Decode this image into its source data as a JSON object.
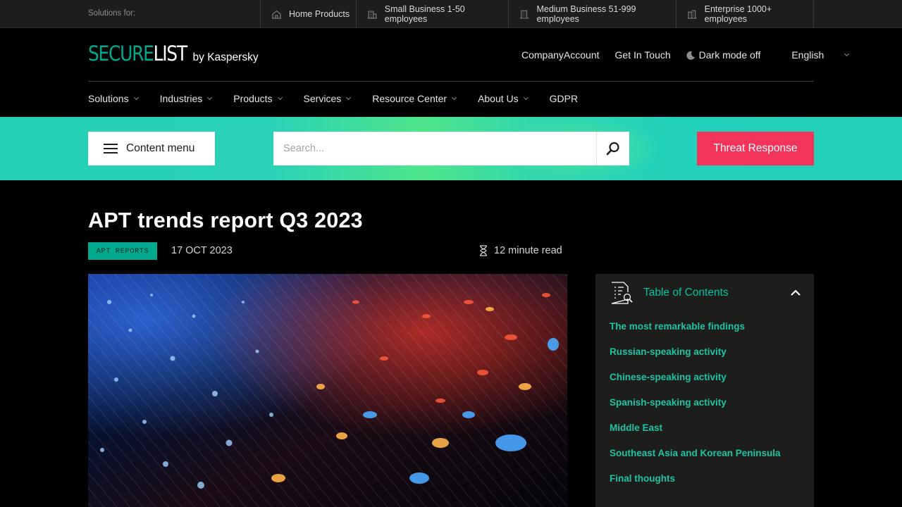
{
  "topbar": {
    "solutions_label": "Solutions for:",
    "segments": [
      {
        "icon": "house-icon",
        "label": "Home Products"
      },
      {
        "icon": "small-building-icon",
        "label": "Small Business 1-50 employees"
      },
      {
        "icon": "medium-building-icon",
        "label": "Medium Business 51-999 employees"
      },
      {
        "icon": "enterprise-building-icon",
        "label": "Enterprise 1000+ employees"
      }
    ]
  },
  "header": {
    "logo_secure": "SECURE",
    "logo_list": "LIST",
    "logo_by": "by Kaspersky",
    "links": {
      "company_account": "CompanyAccount",
      "get_in_touch": "Get In Touch",
      "dark_mode": "Dark mode off",
      "language": "English"
    }
  },
  "nav": {
    "items": [
      "Solutions",
      "Industries",
      "Products",
      "Services",
      "Resource Center",
      "About Us",
      "GDPR"
    ]
  },
  "toolbar": {
    "content_menu": "Content menu",
    "search_placeholder": "Search...",
    "threat_response": "Threat Response"
  },
  "article": {
    "title": "APT trends report Q3 2023",
    "tag": "APT REPORTS",
    "date": "17 OCT 2023",
    "read_time": "12 minute read"
  },
  "toc": {
    "title": "Table of Contents",
    "items": [
      "The most remarkable findings",
      "Russian-speaking activity",
      "Chinese-speaking activity",
      "Spanish-speaking activity",
      "Middle East",
      "Southeast Asia and Korean Peninsula",
      "Final thoughts"
    ]
  },
  "colors": {
    "brand_teal": "#00a88e",
    "threat_red": "#f2345a",
    "band_teal": "#23d0b4",
    "toc_link": "#1ec3a4"
  }
}
